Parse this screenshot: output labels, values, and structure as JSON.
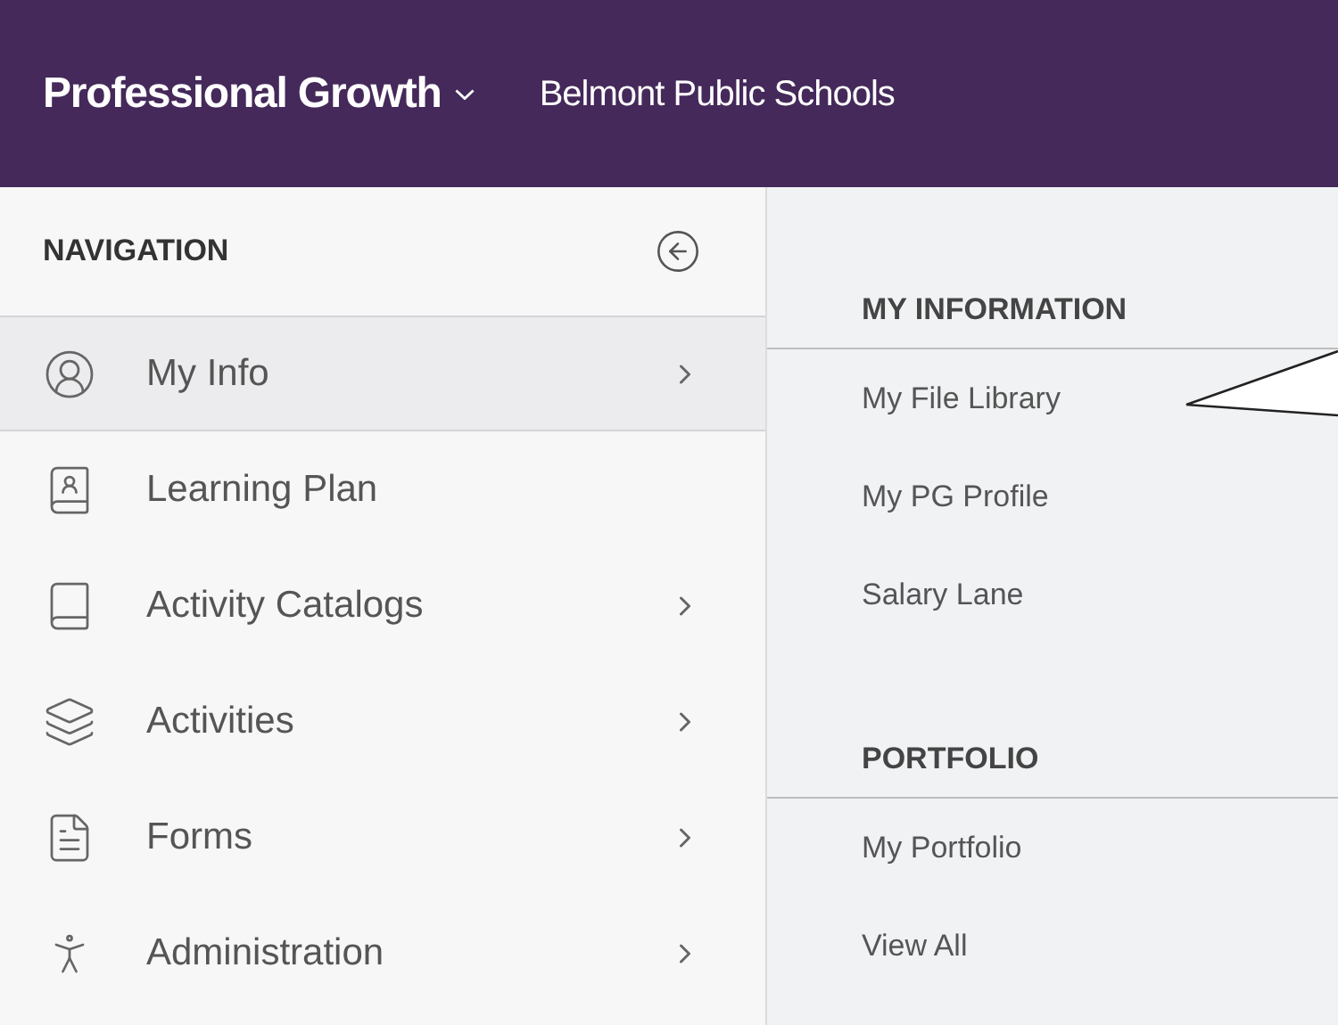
{
  "header": {
    "title": "Professional Growth",
    "organization": "Belmont Public Schools"
  },
  "navigation": {
    "title": "NAVIGATION",
    "items": [
      {
        "label": "My Info",
        "selected": true,
        "has_submenu": true
      },
      {
        "label": "Learning Plan",
        "selected": false,
        "has_submenu": false
      },
      {
        "label": "Activity Catalogs",
        "selected": false,
        "has_submenu": true
      },
      {
        "label": "Activities",
        "selected": false,
        "has_submenu": true
      },
      {
        "label": "Forms",
        "selected": false,
        "has_submenu": true
      },
      {
        "label": "Administration",
        "selected": false,
        "has_submenu": true
      }
    ]
  },
  "submenu": {
    "sections": [
      {
        "title": "MY INFORMATION",
        "items": [
          {
            "label": "My File Library"
          },
          {
            "label": "My PG Profile"
          },
          {
            "label": "Salary Lane"
          }
        ]
      },
      {
        "title": "PORTFOLIO",
        "items": [
          {
            "label": "My Portfolio"
          },
          {
            "label": "View All"
          }
        ]
      }
    ]
  }
}
